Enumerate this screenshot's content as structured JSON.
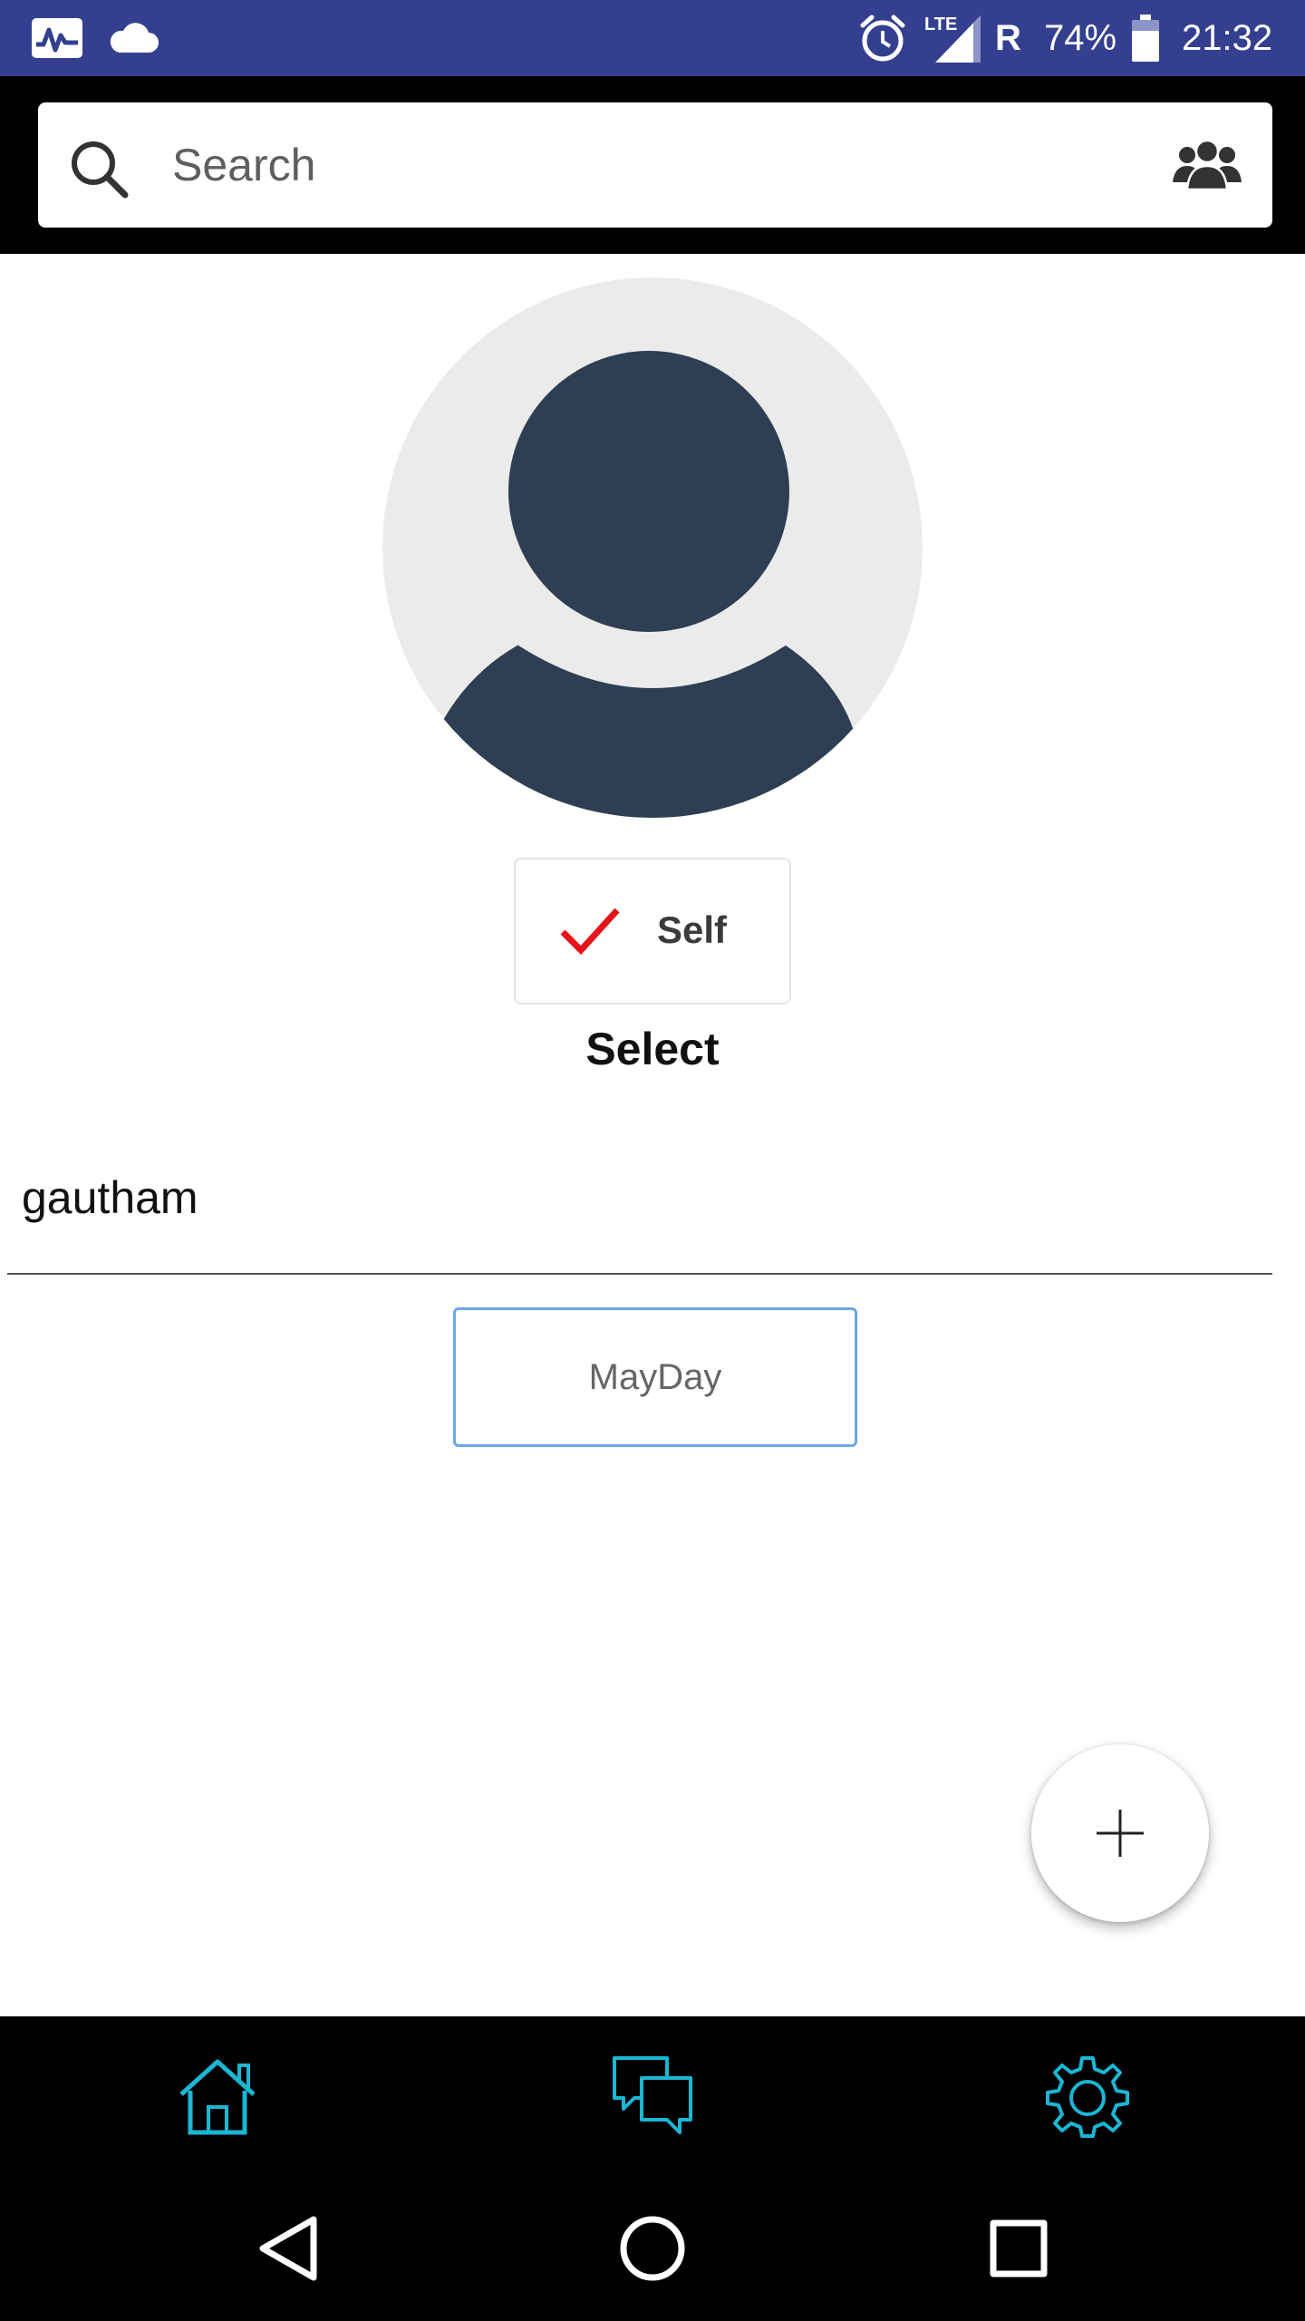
{
  "status_bar": {
    "icons": [
      "activity-icon",
      "cloud-icon",
      "alarm-icon",
      "lte-signal-icon",
      "battery-icon"
    ],
    "network_label": "LTE",
    "roaming": "R",
    "battery": "74%",
    "time": "21:32"
  },
  "search": {
    "placeholder": "Search",
    "value": ""
  },
  "profile": {
    "self_label": "Self",
    "select_label": "Select",
    "name": "gautham"
  },
  "actions": {
    "mayday_label": "MayDay"
  },
  "tabs": [
    {
      "name": "home",
      "icon": "home-icon"
    },
    {
      "name": "chat",
      "icon": "chat-icon"
    },
    {
      "name": "settings",
      "icon": "gear-icon"
    }
  ],
  "colors": {
    "status_bar": "#34408f",
    "accent": "#1ab6d4",
    "check": "#e8141b",
    "avatar_bg": "#ebebeb",
    "avatar_fg": "#2e3e53",
    "mayday_border": "#6aa8e8"
  }
}
